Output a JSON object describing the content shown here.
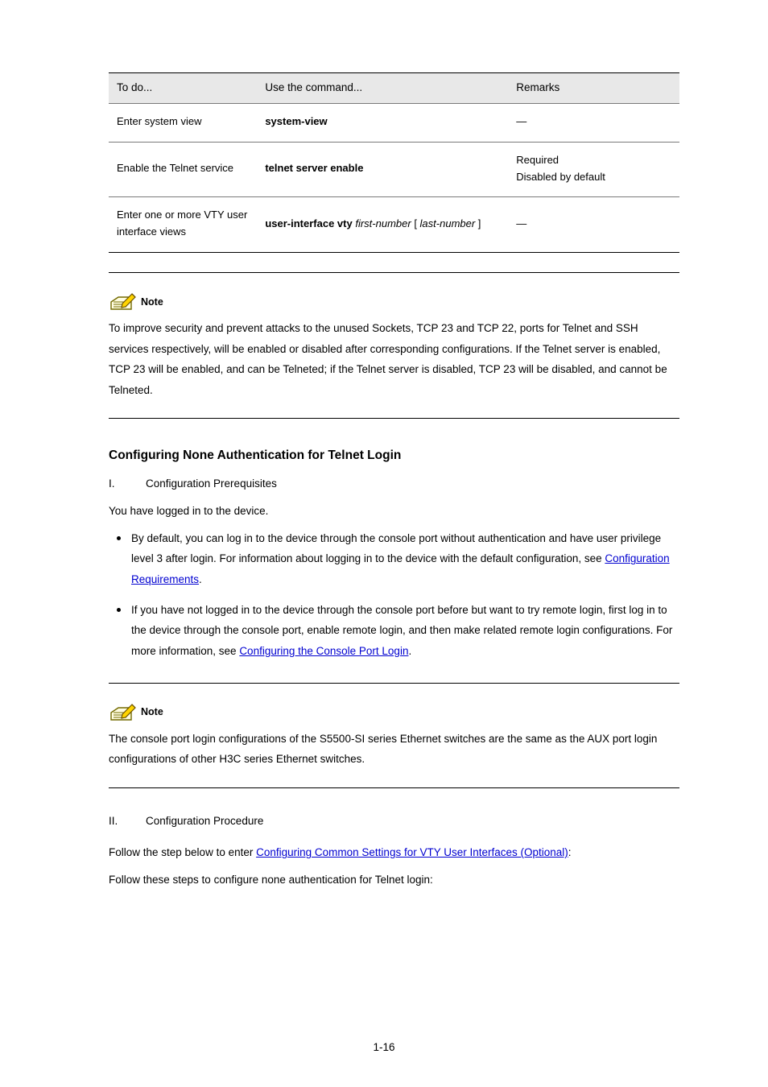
{
  "table": {
    "headers": [
      "To do...",
      "Use the command...",
      "Remarks"
    ],
    "rows": [
      {
        "todo": "Enter system view",
        "cmd": "system-view",
        "remarks": "—"
      },
      {
        "todo": "Enable the Telnet service",
        "cmd": "telnet server enable",
        "remarks": "Required\nDisabled by default"
      },
      {
        "todo": "Enter one or more VTY user interface views",
        "cmd_raw": "user-interface vty first-number [ last-number ]",
        "remarks": "—"
      }
    ]
  },
  "note1": {
    "label": "Note",
    "text": "To improve security and prevent attacks to the unused Sockets, TCP 23 and TCP 22, ports for Telnet and SSH services respectively, will be enabled or disabled after corresponding configurations. If the Telnet server is enabled, TCP 23 will be enabled, and can be Telneted; if the Telnet server is disabled, TCP 23 will be disabled, and cannot be Telneted."
  },
  "section": {
    "heading": "Configuring None Authentication for Telnet Login",
    "intro": "Configuration Prerequisites",
    "para": "You have logged in to the device.",
    "bullets": [
      {
        "pre": "By default, you can log in to the device through the console port without authentication and have user privilege level 3 after login. For information about logging in to the device with the default configuration, see ",
        "link": "Configuration Requirements",
        "post": "."
      },
      {
        "pre": "If you have not logged in to the device through the console port before but want to try remote login, first log in to the device through the console port, enable remote login, and then make related remote login configurations. For more information, see ",
        "link": "Configuring the Console Port Login",
        "post": "."
      }
    ]
  },
  "note2": {
    "label": "Note",
    "text": "The console port login configurations of the S5500-SI series Ethernet switches are the same as the AUX port login configurations of other H3C series Ethernet switches."
  },
  "procedure": {
    "para_pre": "Follow these steps to configure none authentication for Telnet login:",
    "roman_num": "II.",
    "roman_title": "Configuration Procedure",
    "link": "Configuring Common Settings for VTY User Interfaces (Optional)",
    "lead_in_pre": "Follow the step below to enter ",
    "lead_in_post": ":"
  },
  "footer": "1-16"
}
